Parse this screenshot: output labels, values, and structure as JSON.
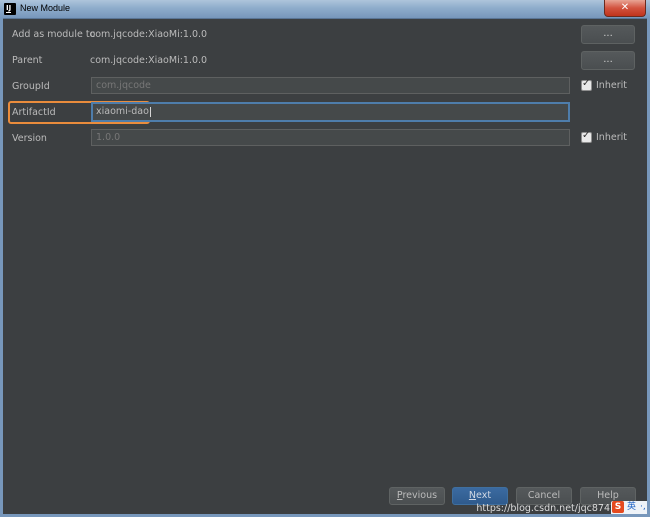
{
  "window": {
    "title": "New Module",
    "app_icon_label": "IJ",
    "close_glyph": "✕"
  },
  "form": {
    "add_as_module_to_label": "Add as module to",
    "add_as_module_to_value": "com.jqcode:XiaoMi:1.0.0",
    "parent_label": "Parent",
    "parent_value": "com.jqcode:XiaoMi:1.0.0",
    "groupid_label": "GroupId",
    "groupid_value": "com.jqcode",
    "artifactid_label": "ArtifactId",
    "artifactid_value": "xiaomi-dao",
    "version_label": "Version",
    "version_value": "1.0.0",
    "ellipsis_label": "...",
    "inherit_label": "Inherit",
    "groupid_inherit_checked": true,
    "version_inherit_checked": true
  },
  "buttons": {
    "previous_mnemonic": "P",
    "previous_rest": "revious",
    "next_mnemonic": "N",
    "next_rest": "ext",
    "cancel": "Cancel",
    "help": "Help"
  },
  "overlay": {
    "watermark": "https://blog.csdn.net/jqc874",
    "tray_s": "S",
    "tray_ying": "英",
    "tray_dot": "·,"
  },
  "colors": {
    "background": "#3c3f41",
    "accent": "#4e7dab",
    "highlight": "#ea8c3c"
  }
}
